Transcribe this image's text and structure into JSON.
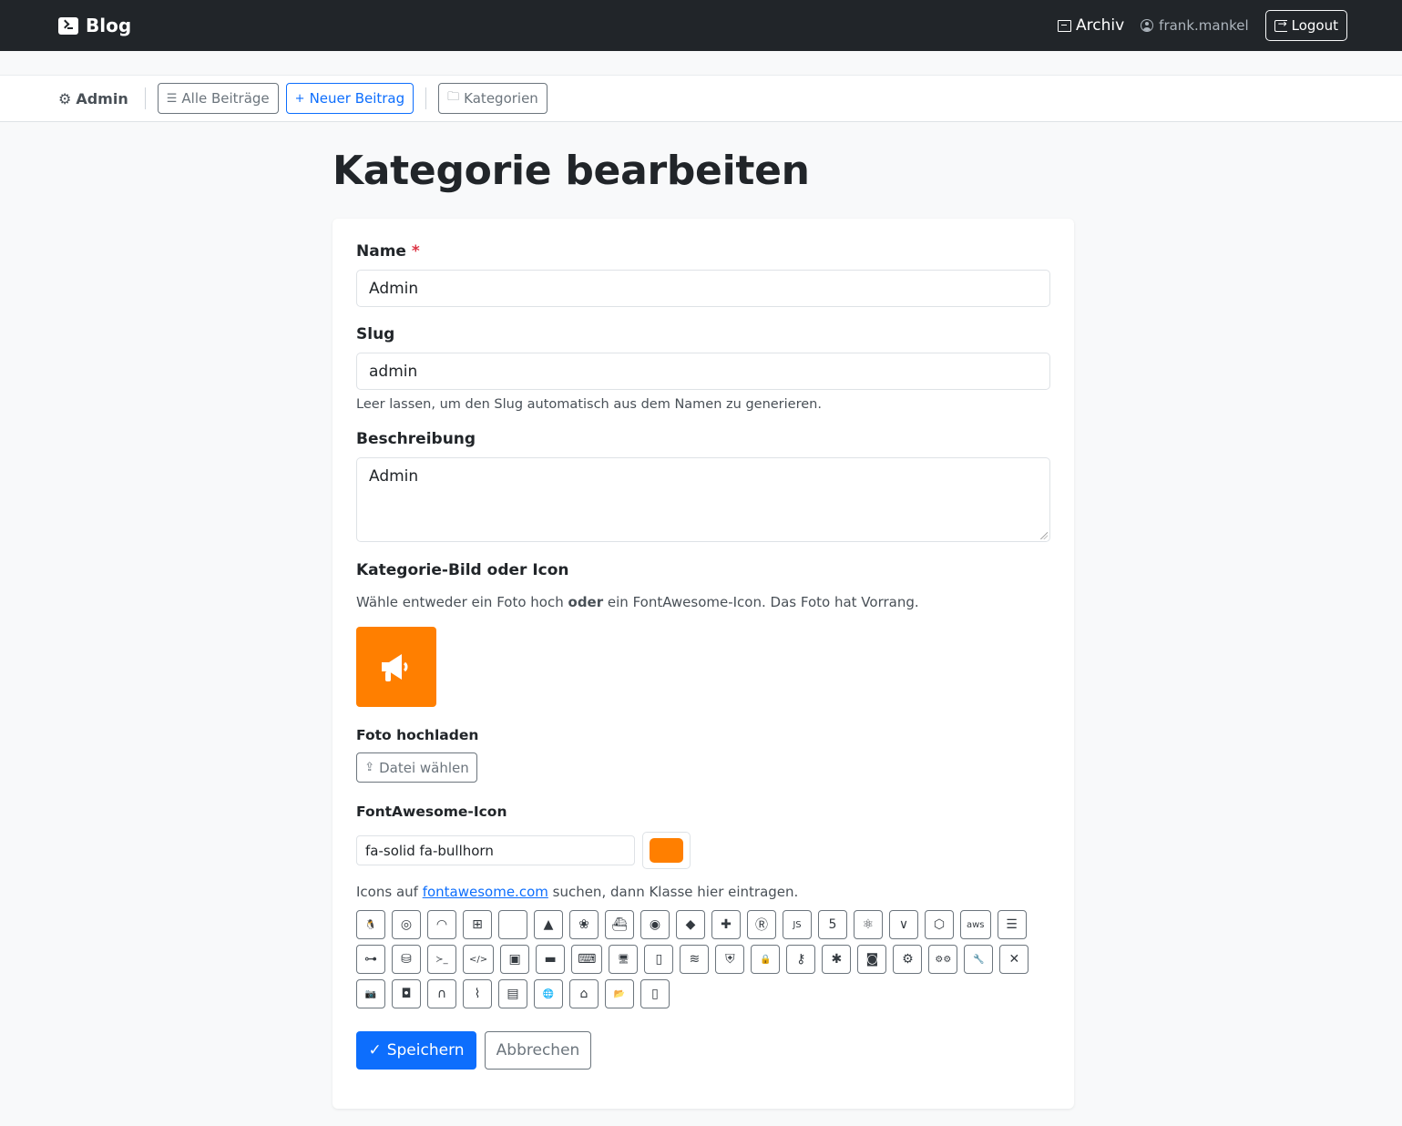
{
  "navbar": {
    "brand": "Blog",
    "archive_label": "Archiv",
    "user_label": "frank.mankel",
    "logout_label": "Logout"
  },
  "adminbar": {
    "admin_label": "Admin",
    "all_posts": "Alle Beiträge",
    "new_post": "Neuer Beitrag",
    "categories": "Kategorien"
  },
  "page": {
    "title": "Kategorie bearbeiten"
  },
  "form": {
    "name_label": "Name",
    "required_mark": "*",
    "name_value": "Admin",
    "slug_label": "Slug",
    "slug_value": "admin",
    "slug_hint": "Leer lassen, um den Slug automatisch aus dem Namen zu generieren.",
    "desc_label": "Beschreibung",
    "desc_value": "Admin",
    "image_section_title": "Kategorie-Bild oder Icon",
    "image_desc_before": "Wähle entweder ein Foto hoch ",
    "image_desc_bold": "oder",
    "image_desc_after": " ein FontAwesome-Icon. Das Foto hat Vorrang.",
    "preview_color": "#ff7f00",
    "photo_label": "Foto hochladen",
    "upload_button": "Datei wählen",
    "fa_label": "FontAwesome-Icon",
    "fa_value": "fa-solid fa-bullhorn",
    "fa_color": "#ff7f00",
    "fa_hint_before": "Icons auf ",
    "fa_hint_link": "fontawesome.com",
    "fa_hint_after": " suchen, dann Klasse hier eintragen.",
    "save_button": "Speichern",
    "cancel_button": "Abbrechen"
  },
  "icon_options": [
    {
      "name": "linux-icon",
      "glyph": "🐧"
    },
    {
      "name": "ubuntu-icon",
      "glyph": "◎"
    },
    {
      "name": "debian-icon",
      "glyph": "◠"
    },
    {
      "name": "windows-icon",
      "glyph": "⊞"
    },
    {
      "name": "apple-icon",
      "glyph": ""
    },
    {
      "name": "android-icon",
      "glyph": "▲"
    },
    {
      "name": "raspberry-pi-icon",
      "glyph": "❀"
    },
    {
      "name": "docker-icon",
      "glyph": "⛴"
    },
    {
      "name": "github-icon",
      "glyph": "◉"
    },
    {
      "name": "git-icon",
      "glyph": "◆"
    },
    {
      "name": "python-icon",
      "glyph": "✚"
    },
    {
      "name": "rust-icon",
      "glyph": "Ⓡ"
    },
    {
      "name": "js-icon",
      "glyph": "JS"
    },
    {
      "name": "html5-icon",
      "glyph": "5"
    },
    {
      "name": "react-icon",
      "glyph": "⚛"
    },
    {
      "name": "vue-icon",
      "glyph": "∨"
    },
    {
      "name": "node-icon",
      "glyph": "⬡"
    },
    {
      "name": "aws-icon",
      "glyph": "aws"
    },
    {
      "name": "server-icon",
      "glyph": "☰"
    },
    {
      "name": "network-icon",
      "glyph": "⊶"
    },
    {
      "name": "database-icon",
      "glyph": "⛁"
    },
    {
      "name": "terminal-icon",
      "glyph": "≻_"
    },
    {
      "name": "code-icon",
      "glyph": "</>"
    },
    {
      "name": "microchip-icon",
      "glyph": "▣"
    },
    {
      "name": "hard-drive-icon",
      "glyph": "▬"
    },
    {
      "name": "laptop-icon",
      "glyph": "⌨"
    },
    {
      "name": "desktop-icon",
      "glyph": "🖥"
    },
    {
      "name": "mobile-icon",
      "glyph": "▯"
    },
    {
      "name": "wifi-icon",
      "glyph": "≋"
    },
    {
      "name": "shield-icon",
      "glyph": "⛨"
    },
    {
      "name": "lock-icon",
      "glyph": "🔒"
    },
    {
      "name": "key-icon",
      "glyph": "⚷"
    },
    {
      "name": "bug-icon",
      "glyph": "✱"
    },
    {
      "name": "robot-icon",
      "glyph": "◙"
    },
    {
      "name": "gear-icon",
      "glyph": "⚙"
    },
    {
      "name": "gears-icon",
      "glyph": "⚙⚙"
    },
    {
      "name": "wrench-icon",
      "glyph": "🔧"
    },
    {
      "name": "tools-icon",
      "glyph": "✕"
    },
    {
      "name": "camera-icon",
      "glyph": "📷"
    },
    {
      "name": "gamepad-icon",
      "glyph": "◘"
    },
    {
      "name": "headset-icon",
      "glyph": "∩"
    },
    {
      "name": "rss-icon",
      "glyph": "⌇"
    },
    {
      "name": "newspaper-icon",
      "glyph": "▤"
    },
    {
      "name": "globe-icon",
      "glyph": "🌐"
    },
    {
      "name": "house-icon",
      "glyph": "⌂"
    },
    {
      "name": "folder-open-icon",
      "glyph": "📂"
    },
    {
      "name": "file-code-icon",
      "glyph": "▯"
    }
  ]
}
